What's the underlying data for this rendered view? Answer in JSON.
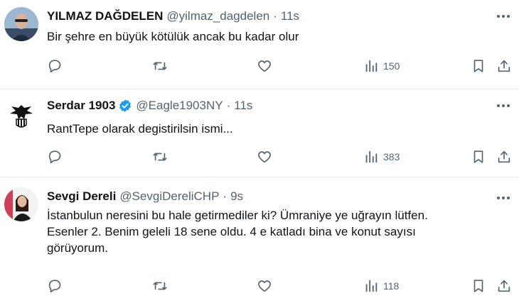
{
  "tweets": [
    {
      "name": "YILMAZ DAĞDELEN",
      "handle": "@yilmaz_dagdelen",
      "separator": "·",
      "time": "11s",
      "verified": false,
      "lines": [
        "Bir şehre en büyük kötülük ancak bu kadar olur"
      ],
      "views": "150",
      "icons": {
        "reply": "reply-icon",
        "retweet": "retweet-icon",
        "like": "heart-icon",
        "views": "views-icon",
        "bookmark": "bookmark-icon",
        "share": "share-icon",
        "more": "more-icon"
      }
    },
    {
      "name": "Serdar 1903",
      "handle": "@Eagle1903NY",
      "separator": "·",
      "time": "11s",
      "verified": true,
      "verified_color": "#1d9bf0",
      "lines": [
        "RantTepe olarak degistirilsin ismi..."
      ],
      "views": "383"
    },
    {
      "name": "Sevgi Dereli",
      "handle": "@SevgiDereliCHP",
      "separator": "·",
      "time": "9s",
      "verified": false,
      "lines": [
        "İstanbulun neresini bu hale getirmediler ki? Ümraniye ye uğrayın lütfen.",
        "Esenler 2.  Benim geleli 18 sene oldu. 4 e katladı bina ve konut sayısı",
        "görüyorum."
      ],
      "views": "118"
    }
  ],
  "colors": {
    "text": "#0f1419",
    "muted": "#536471",
    "divider": "#e6ecf0",
    "accent": "#1d9bf0"
  }
}
